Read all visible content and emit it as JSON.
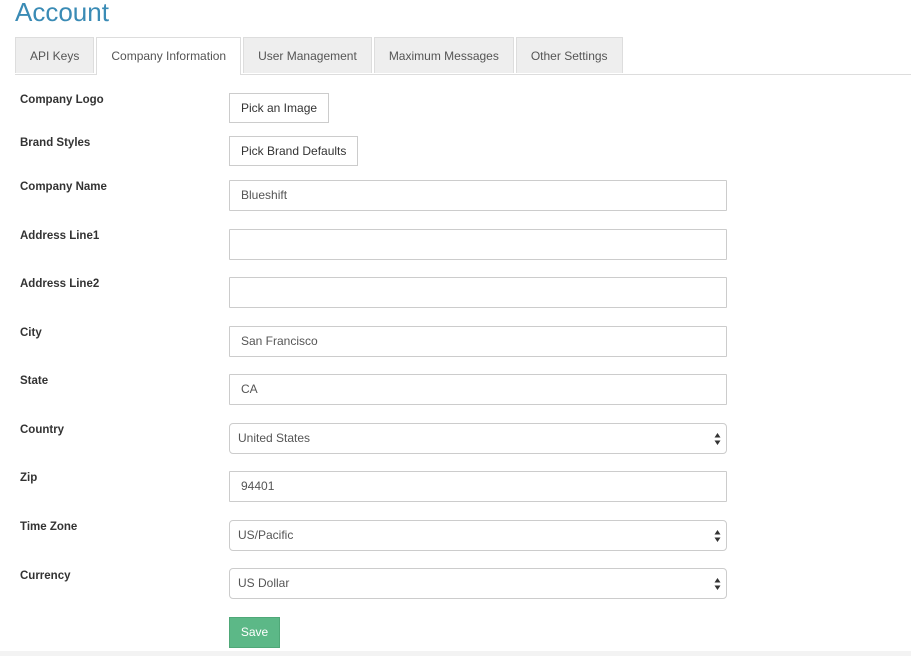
{
  "header": {
    "title": "Account"
  },
  "tabs": [
    {
      "label": "API Keys",
      "active": false
    },
    {
      "label": "Company Information",
      "active": true
    },
    {
      "label": "User Management",
      "active": false
    },
    {
      "label": "Maximum Messages",
      "active": false
    },
    {
      "label": "Other Settings",
      "active": false
    }
  ],
  "form": {
    "company_logo": {
      "label": "Company Logo",
      "button": "Pick an Image"
    },
    "brand_styles": {
      "label": "Brand Styles",
      "button": "Pick Brand Defaults"
    },
    "company_name": {
      "label": "Company Name",
      "value": "Blueshift"
    },
    "address_line1": {
      "label": "Address Line1",
      "value": ""
    },
    "address_line2": {
      "label": "Address Line2",
      "value": ""
    },
    "city": {
      "label": "City",
      "value": "San Francisco"
    },
    "state": {
      "label": "State",
      "value": "CA"
    },
    "country": {
      "label": "Country",
      "value": "United States"
    },
    "zip": {
      "label": "Zip",
      "value": "94401"
    },
    "time_zone": {
      "label": "Time Zone",
      "value": "US/Pacific"
    },
    "currency": {
      "label": "Currency",
      "value": "US Dollar"
    },
    "save_label": "Save"
  },
  "colors": {
    "title": "#3a8bb5",
    "save_button": "#5cb887",
    "tab_inactive": "#eeeeee"
  },
  "icons": {
    "select_arrows": "updown-arrows-icon"
  }
}
